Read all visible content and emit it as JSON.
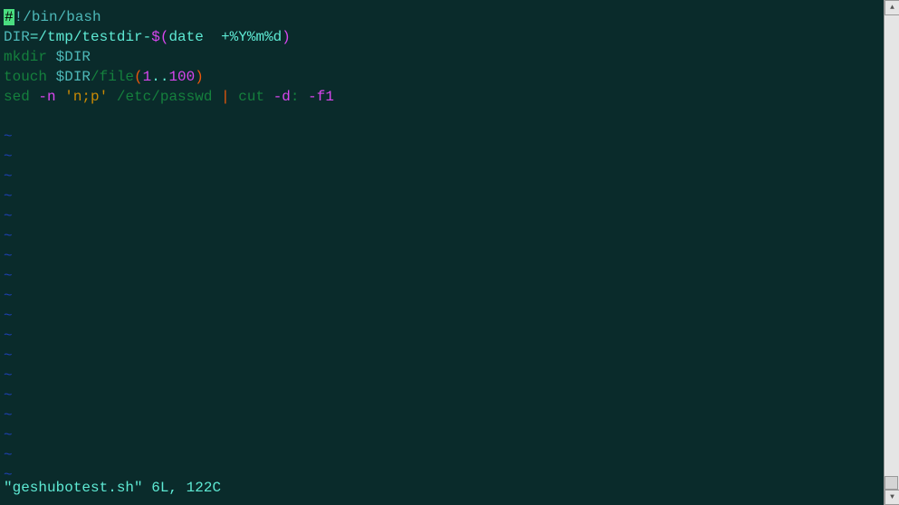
{
  "editor": {
    "line1": {
      "shebang_hash": "#",
      "shebang_rest": "!/bin/bash"
    },
    "line2": {
      "var": "DIR",
      "eq": "=",
      "path": "/tmp/testdir-",
      "subst_open": "$(",
      "cmd": "date",
      "space": "  ",
      "fmt": "+%Y%m%d",
      "subst_close": ")"
    },
    "line3": {
      "cmd": "mkdir ",
      "var": "$DIR"
    },
    "line4": {
      "cmd": "touch ",
      "var": "$DIR",
      "slash": "/",
      "name": "file",
      "paren_open": "(",
      "num1": "1",
      "dots": "..",
      "num2": "100",
      "paren_close": ")"
    },
    "line5": {
      "cmd1": "sed ",
      "flag1": "-n",
      "space1": " ",
      "str": "'n;p'",
      "space2": " ",
      "path": "/etc/passwd",
      "space3": " ",
      "pipe": "|",
      "space4": " ",
      "cmd2": "cut ",
      "flag2": "-d",
      "colon": ":",
      "space5": " ",
      "flag3": "-f1"
    },
    "tilde": "~",
    "status": {
      "filename": "\"geshubotest.sh\"",
      "info": " 6L, 122C"
    }
  }
}
